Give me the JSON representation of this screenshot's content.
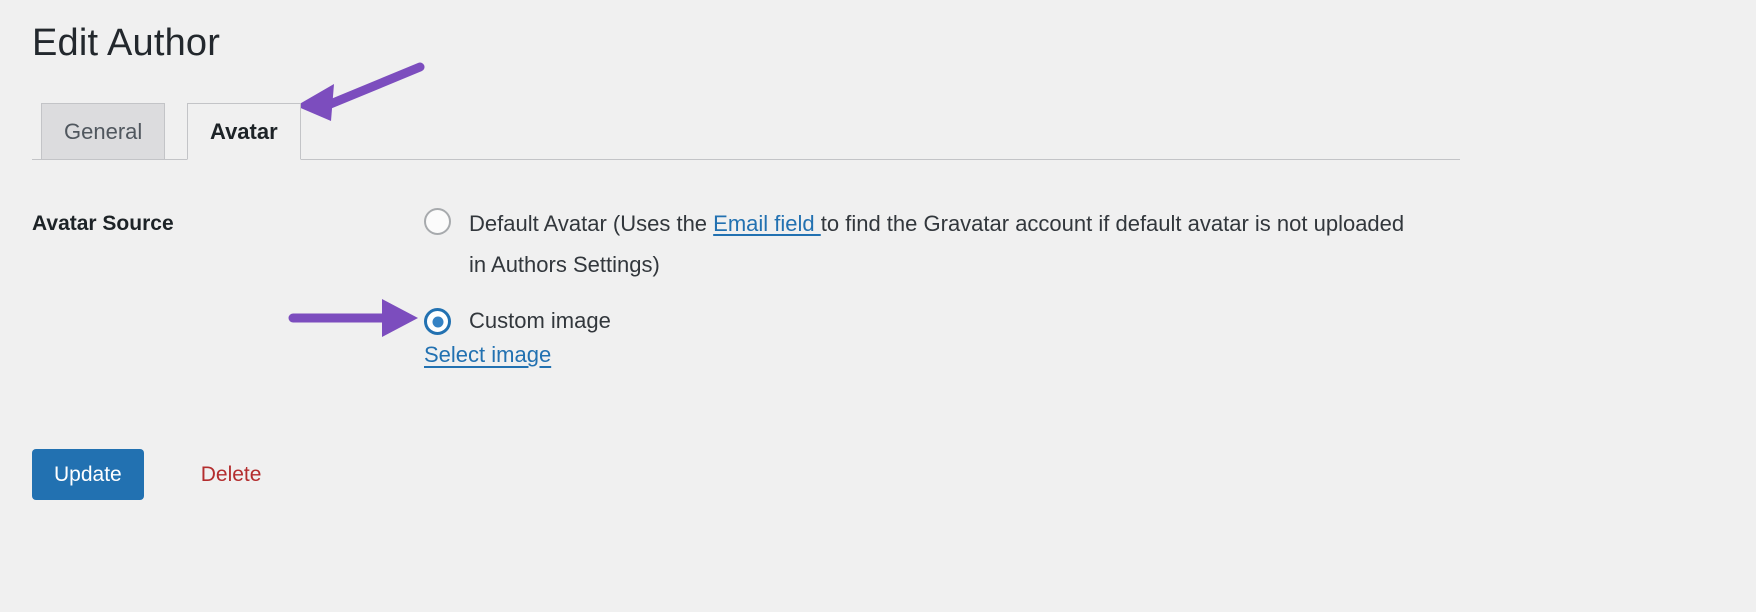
{
  "page": {
    "title": "Edit Author"
  },
  "tabs": [
    {
      "id": "general",
      "label": "General",
      "active": false
    },
    {
      "id": "avatar",
      "label": "Avatar",
      "active": true
    }
  ],
  "form": {
    "field_label": "Avatar Source",
    "options": [
      {
        "id": "default-avatar",
        "selected": false,
        "text_before": "Default Avatar (Uses the ",
        "link_text": "Email field ",
        "text_after": "to find the Gravatar account if default avatar is not uploaded in Authors Settings)"
      },
      {
        "id": "custom-image",
        "selected": true,
        "text": "Custom image"
      }
    ],
    "select_image_link": "Select image"
  },
  "actions": {
    "update_label": "Update",
    "delete_label": "Delete"
  },
  "colors": {
    "page_background": "#f0f0f0",
    "accent_blue": "#2271b1",
    "radio_fill_blue": "#3582c4",
    "delete_red": "#b32d2e",
    "annotation_purple": "#7c4dbe",
    "tab_inactive_bg": "#dcdcde",
    "border_gray": "#c3c4c7",
    "text_dark": "#32373c"
  },
  "annotations": [
    {
      "id": "arrow-to-avatar-tab",
      "icon": "arrow-icon",
      "points_to": "Avatar"
    },
    {
      "id": "arrow-to-custom-image-radio",
      "icon": "arrow-icon",
      "points_to": "Custom image"
    }
  ]
}
